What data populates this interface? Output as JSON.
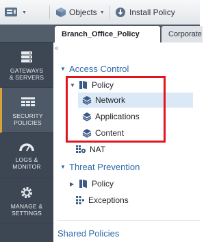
{
  "toolbar": {
    "objects_label": "Objects",
    "install_label": "Install Policy"
  },
  "nav": {
    "items": [
      {
        "label": "GATEWAYS\n& SERVERS",
        "icon": "gateways-servers-icon",
        "active": false
      },
      {
        "label": "SECURITY\nPOLICIES",
        "icon": "security-policies-icon",
        "active": true
      },
      {
        "label": "LOGS &\nMONITOR",
        "icon": "logs-monitor-icon",
        "active": false
      },
      {
        "label": "MANAGE &\nSETTINGS",
        "icon": "manage-settings-icon",
        "active": false
      }
    ]
  },
  "tabs": [
    {
      "label": "Branch_Office_Policy",
      "active": true
    },
    {
      "label": "Corporate",
      "active": false
    }
  ],
  "tree": {
    "access_control": "Access Control",
    "policy": "Policy",
    "network": "Network",
    "applications": "Applications",
    "content": "Content",
    "nat": "NAT",
    "threat_prevention": "Threat Prevention",
    "tp_policy": "Policy",
    "exceptions": "Exceptions",
    "shared_policies": "Shared Policies"
  },
  "colors": {
    "accent": "#2c6aa9",
    "highlight_box": "#e0151d",
    "nav_bg": "#3d4754",
    "nav_active_marker": "#d8a43a"
  }
}
